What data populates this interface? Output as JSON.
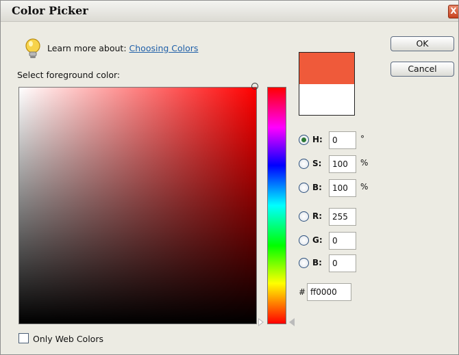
{
  "window": {
    "title": "Color Picker",
    "close_label": "X"
  },
  "learn": {
    "prefix": "Learn more about:",
    "link": "Choosing Colors"
  },
  "select_label": "Select foreground color:",
  "buttons": {
    "ok": "OK",
    "cancel": "Cancel"
  },
  "fields": [
    {
      "label": "H:",
      "value": "0",
      "unit": "°",
      "selected": true
    },
    {
      "label": "S:",
      "value": "100",
      "unit": "%",
      "selected": false
    },
    {
      "label": "B:",
      "value": "100",
      "unit": "%",
      "selected": false
    },
    {
      "label": "R:",
      "value": "255",
      "unit": "",
      "selected": false
    },
    {
      "label": "G:",
      "value": "0",
      "unit": "",
      "selected": false
    },
    {
      "label": "B:",
      "value": "0",
      "unit": "",
      "selected": false
    }
  ],
  "hex": {
    "prefix": "#",
    "value": "ff0000"
  },
  "web_colors": {
    "label": "Only Web Colors",
    "checked": false
  },
  "colors": {
    "new_color": "#ef5a3a",
    "old_color": "#ffffff",
    "selected_hue": "#ff0000"
  },
  "icons": {
    "tip": "lightbulb-icon"
  }
}
